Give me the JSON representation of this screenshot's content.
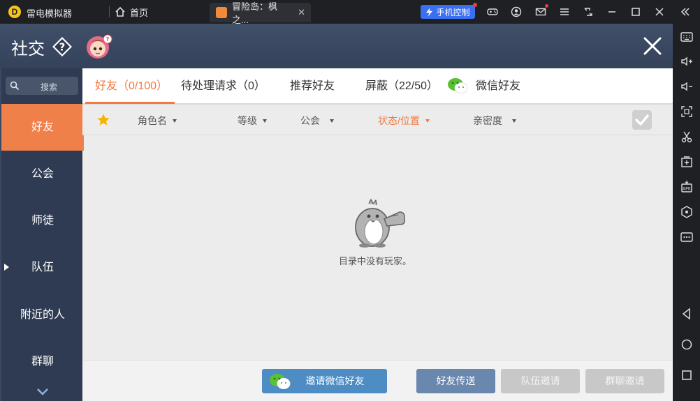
{
  "titlebar": {
    "app_name": "雷电模拟器",
    "home_label": "首页",
    "tab_title": "冒险岛：枫之...",
    "tab_close": "✕",
    "phone_control": "手机控制"
  },
  "game": {
    "title": "社交",
    "search_placeholder": "搜索",
    "menu": [
      {
        "label": "好友",
        "active": true
      },
      {
        "label": "公会",
        "active": false
      },
      {
        "label": "师徒",
        "active": false
      },
      {
        "label": "队伍",
        "active": false
      },
      {
        "label": "附近的人",
        "active": false
      },
      {
        "label": "群聊",
        "active": false
      }
    ],
    "tabs": [
      {
        "label": "好友（0/100）",
        "active": true
      },
      {
        "label": "待处理请求（0）",
        "active": false
      },
      {
        "label": "推荐好友",
        "active": false
      },
      {
        "label": "屏蔽（22/50）",
        "active": false
      },
      {
        "label": "微信好友",
        "active": false
      }
    ],
    "columns": [
      {
        "label": "角色名",
        "highlight": false
      },
      {
        "label": "等级",
        "highlight": false
      },
      {
        "label": "公会",
        "highlight": false
      },
      {
        "label": "状态/位置",
        "highlight": true
      },
      {
        "label": "亲密度",
        "highlight": false
      }
    ],
    "empty_message": "目录中没有玩家。",
    "buttons": {
      "invite_wechat": "邀请微信好友",
      "friend_send": "好友传送",
      "team_invite": "队伍邀请",
      "group_invite": "群聊邀请"
    }
  },
  "colors": {
    "accent": "#f07a40",
    "header": "#3a4860",
    "sidebar": "#2e3b52",
    "wechat_button": "#4d8dc4",
    "primary_button": "#6a87ad",
    "disabled_button": "#c8c8c8",
    "phone_control": "#3a6ff0"
  }
}
